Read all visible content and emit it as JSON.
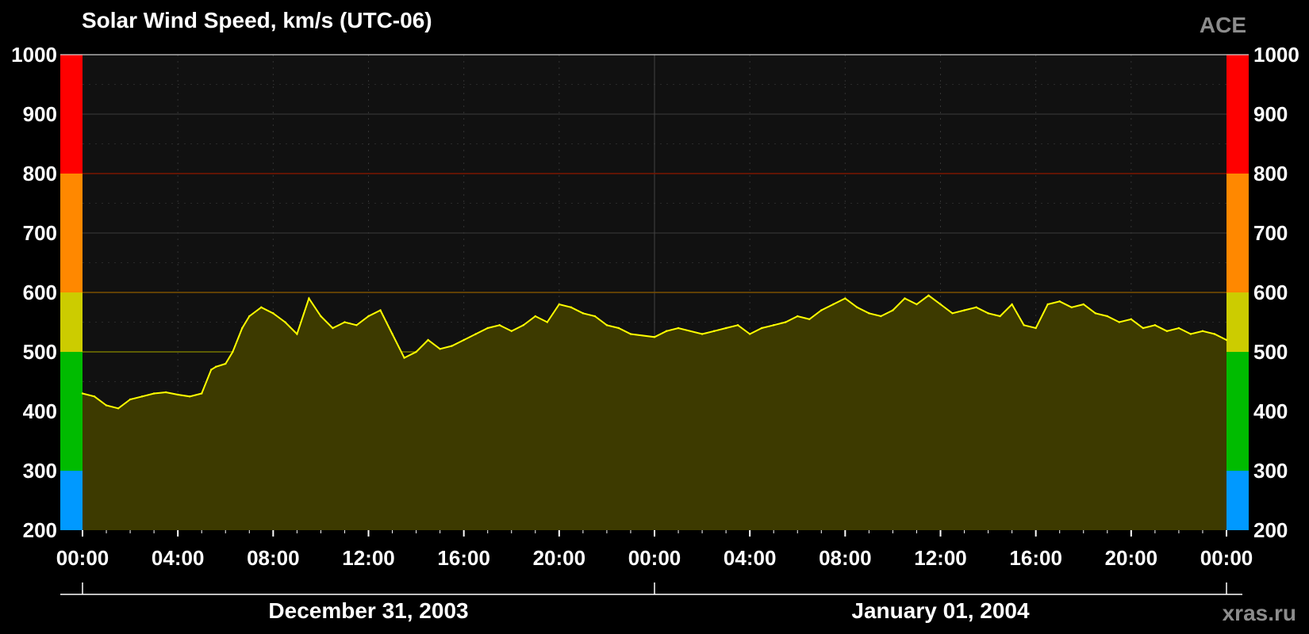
{
  "chart_data": {
    "type": "area",
    "title": "Solar Wind Speed, km/s (UTC-06)",
    "source": "ACE",
    "credit": "xras.ru",
    "ylim": [
      200,
      1000
    ],
    "y_ticks": [
      "200",
      "300",
      "400",
      "500",
      "600",
      "700",
      "800",
      "900",
      "1000"
    ],
    "x_tick_labels": [
      "00:00",
      "04:00",
      "08:00",
      "12:00",
      "16:00",
      "20:00",
      "00:00",
      "04:00",
      "08:00",
      "12:00",
      "16:00",
      "20:00",
      "00:00"
    ],
    "x_range_hours": [
      0,
      48
    ],
    "date_labels": [
      "December 31, 2003",
      "January 01, 2004"
    ],
    "thresholds": [
      300,
      500,
      600,
      800
    ],
    "level_colors": {
      "below_300": "#0099ff",
      "300_500": "#00bb00",
      "500_600": "#cccc00",
      "600_800": "#ff8800",
      "above_800": "#ff0000"
    },
    "series_color": "#ffff00",
    "fill_color": "#3d3a00",
    "points_hours": [
      0,
      0.5,
      1,
      1.5,
      2,
      2.5,
      3,
      3.5,
      4,
      4.5,
      5,
      5.4,
      5.6,
      6,
      6.3,
      6.7,
      7,
      7.5,
      8,
      8.5,
      9,
      9.5,
      10,
      10.5,
      11,
      11.5,
      12,
      12.5,
      13,
      13.5,
      14,
      14.5,
      15,
      15.5,
      16,
      16.5,
      17,
      17.5,
      18,
      18.5,
      19,
      19.5,
      20,
      20.5,
      21,
      21.5,
      22,
      22.5,
      23,
      24,
      24.5,
      25,
      26,
      26.5,
      27,
      27.5,
      28,
      28.5,
      29,
      29.5,
      30,
      30.5,
      31,
      31.5,
      32,
      32.5,
      33,
      33.5,
      34,
      34.5,
      35,
      35.5,
      36,
      36.5,
      37,
      37.5,
      38,
      38.5,
      39,
      39.5,
      40,
      40.5,
      41,
      41.5,
      42,
      42.5,
      43,
      43.5,
      44,
      44.5,
      45,
      45.5,
      46,
      46.5,
      47,
      47.5,
      48
    ],
    "points_speed": [
      430,
      425,
      410,
      405,
      420,
      425,
      430,
      432,
      428,
      425,
      430,
      470,
      475,
      480,
      500,
      540,
      560,
      575,
      565,
      550,
      530,
      590,
      560,
      540,
      550,
      545,
      560,
      570,
      530,
      490,
      500,
      520,
      505,
      510,
      520,
      530,
      540,
      545,
      535,
      545,
      560,
      550,
      580,
      575,
      565,
      560,
      545,
      540,
      530,
      525,
      535,
      540,
      530,
      535,
      540,
      545,
      530,
      540,
      545,
      550,
      560,
      555,
      570,
      580,
      590,
      575,
      565,
      560,
      570,
      590,
      580,
      595,
      580,
      565,
      570,
      575,
      565,
      560,
      580,
      545,
      540,
      580,
      585,
      575,
      580,
      565,
      560,
      550,
      555,
      540,
      545,
      535,
      540,
      530,
      535,
      530,
      520
    ]
  }
}
